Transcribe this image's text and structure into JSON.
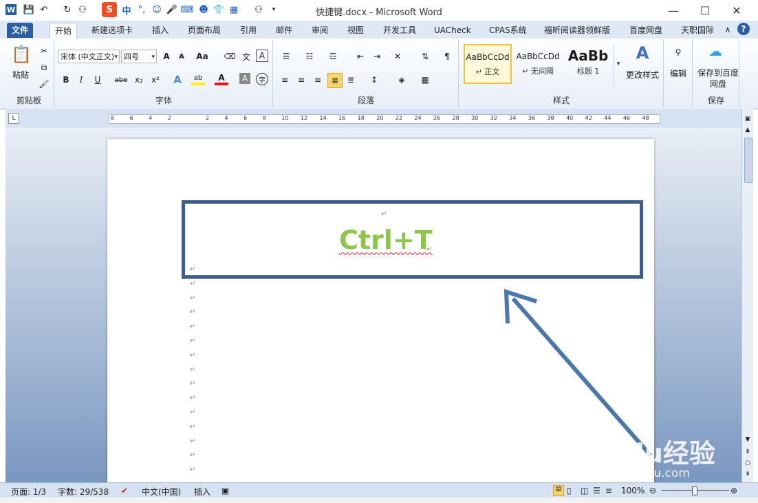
{
  "window": {
    "title": "快捷键.docx - Microsoft Word",
    "controls": {
      "minimize": "—",
      "maximize": "☐",
      "close": "✕"
    }
  },
  "quick_access": {
    "app_icon": "W",
    "ime": {
      "logo": "S",
      "lang": "中",
      "punct": "°,"
    }
  },
  "tabs": [
    {
      "label": "文件"
    },
    {
      "label": "开始"
    },
    {
      "label": "新建选项卡"
    },
    {
      "label": "插入"
    },
    {
      "label": "页面布局"
    },
    {
      "label": "引用"
    },
    {
      "label": "邮件"
    },
    {
      "label": "审阅"
    },
    {
      "label": "视图"
    },
    {
      "label": "开发工具"
    },
    {
      "label": "UACheck"
    },
    {
      "label": "CPAS系统"
    },
    {
      "label": "福昕阅读器领鲜版"
    },
    {
      "label": "百度网盘"
    },
    {
      "label": "天职国际"
    }
  ],
  "ribbon": {
    "clipboard": {
      "label": "剪贴板",
      "paste": "粘贴"
    },
    "font": {
      "label": "字体",
      "font_name": "宋体 (中文正文)",
      "font_size": "四号",
      "grow": "A",
      "shrink": "A",
      "case": "Aa",
      "phonetic": "文",
      "border": "A",
      "bold": "B",
      "italic": "I",
      "underline": "U",
      "strike": "abe",
      "sub": "x₂",
      "sup": "x²",
      "effect": "A",
      "highlight": "ab",
      "fontcolor": "A",
      "shade": "A",
      "enclose": "字"
    },
    "paragraph": {
      "label": "段落"
    },
    "styles": {
      "label": "样式",
      "items": [
        {
          "preview": "AaBbCcDd",
          "name": "↵ 正文"
        },
        {
          "preview": "AaBbCcDd",
          "name": "↵ 无间隔"
        },
        {
          "preview": "AaBb",
          "name": "标题 1"
        }
      ],
      "change": "更改样式"
    },
    "editing": {
      "label": "编辑"
    },
    "save": {
      "label": "保存",
      "button": "保存到百度网盘"
    }
  },
  "ruler": {
    "ticks": [
      "8",
      "6",
      "4",
      "2",
      "",
      "2",
      "4",
      "6",
      "8",
      "10",
      "12",
      "14",
      "16",
      "18",
      "20",
      "22",
      "24",
      "26",
      "28",
      "30",
      "32",
      "34",
      "36",
      "38",
      "40",
      "42",
      "44",
      "46",
      "48"
    ]
  },
  "document": {
    "content": "Ctrl+T",
    "para_mark": "↵"
  },
  "status": {
    "page": "页面: 1/3",
    "words": "字数: 29/538",
    "lang": "中文(中国)",
    "mode": "插入",
    "zoom": "100%"
  },
  "watermark": {
    "brand": "Baidu经验",
    "url": "jingyan.baidu.com"
  },
  "colors": {
    "accent": "#2a5fa7",
    "content": "#8dc54a",
    "frame": "#3b5d8b"
  }
}
